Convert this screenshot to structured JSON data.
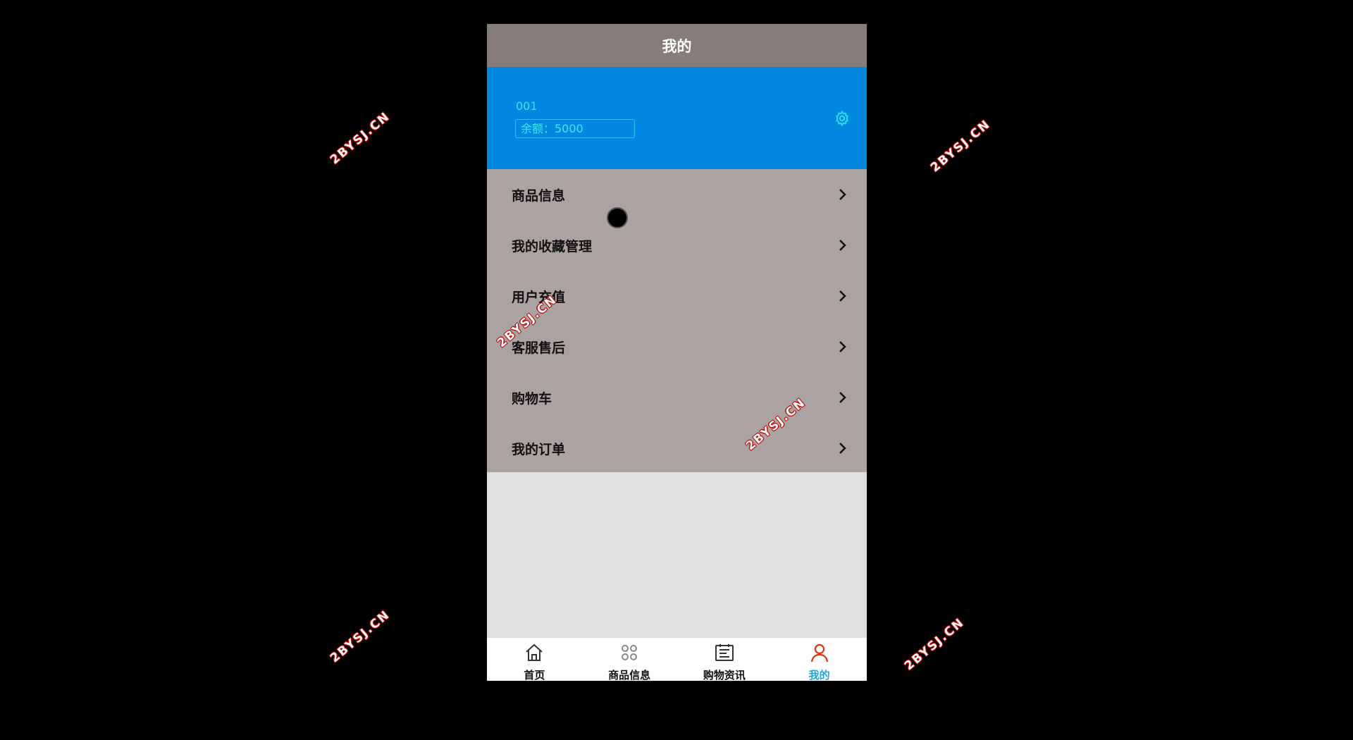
{
  "header": {
    "title": "我的"
  },
  "profile": {
    "username": "001",
    "balance": "余额：5000",
    "settings_icon": "gear-icon"
  },
  "menu": {
    "items": [
      {
        "label": "商品信息",
        "icon": "chevron-right-icon"
      },
      {
        "label": "我的收藏管理",
        "icon": "chevron-right-icon"
      },
      {
        "label": "用户充值",
        "icon": "chevron-right-icon"
      },
      {
        "label": "客服售后",
        "icon": "chevron-right-icon"
      },
      {
        "label": "购物车",
        "icon": "chevron-right-icon"
      },
      {
        "label": "我的订单",
        "icon": "chevron-right-icon"
      }
    ]
  },
  "tabbar": {
    "tabs": [
      {
        "label": "首页",
        "icon": "home-icon"
      },
      {
        "label": "商品信息",
        "icon": "grid-icon"
      },
      {
        "label": "购物资讯",
        "icon": "news-icon"
      },
      {
        "label": "我的",
        "icon": "user-icon",
        "active": true
      }
    ]
  },
  "watermark": {
    "text": "2BYSJ.CN"
  },
  "colors": {
    "header_bg": "#867d7b",
    "profile_bg": "#0088e0",
    "profile_text": "#40e0e8",
    "menu_bg": "#aaa3a1",
    "active_tab": "#1aa6d8",
    "active_icon": "#e03010"
  }
}
